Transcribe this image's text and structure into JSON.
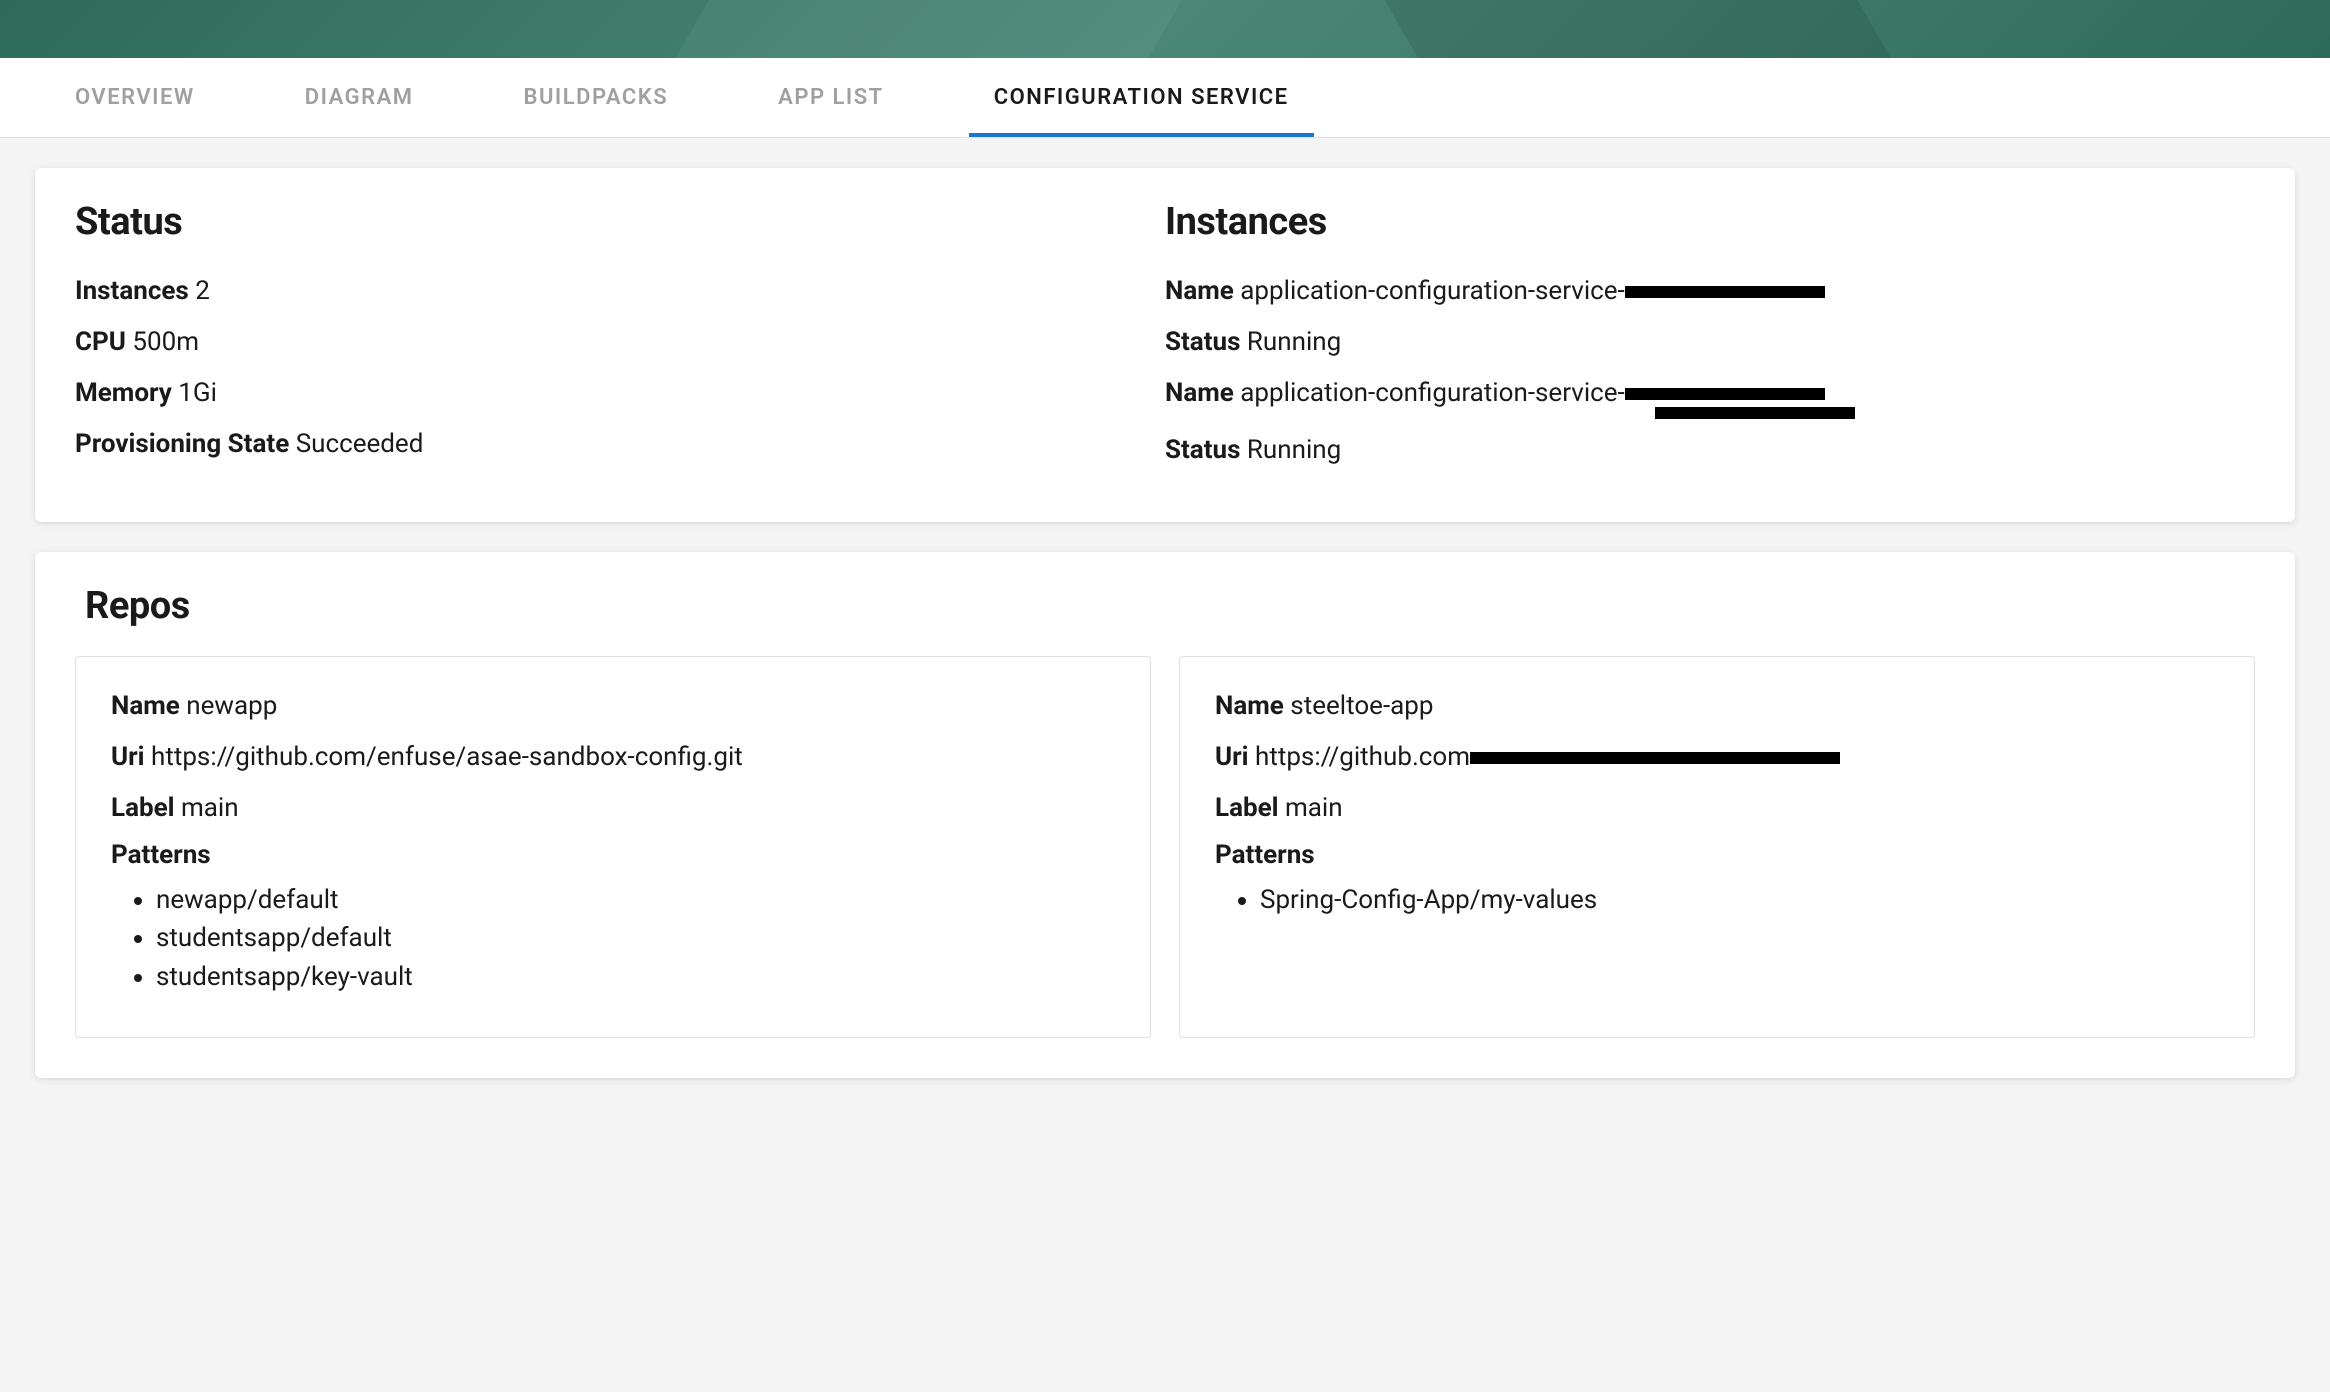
{
  "tabs": [
    {
      "label": "OVERVIEW",
      "active": false
    },
    {
      "label": "DIAGRAM",
      "active": false
    },
    {
      "label": "BUILDPACKS",
      "active": false
    },
    {
      "label": "APP LIST",
      "active": false
    },
    {
      "label": "CONFIGURATION SERVICE",
      "active": true
    }
  ],
  "status": {
    "title": "Status",
    "instances_label": "Instances",
    "instances_value": "2",
    "cpu_label": "CPU",
    "cpu_value": "500m",
    "memory_label": "Memory",
    "memory_value": "1Gi",
    "provisioning_label": "Provisioning State",
    "provisioning_value": "Succeeded"
  },
  "instances": {
    "title": "Instances",
    "items": [
      {
        "name_label": "Name",
        "name_value": "application-configuration-service-",
        "status_label": "Status",
        "status_value": "Running"
      },
      {
        "name_label": "Name",
        "name_value": "application-configuration-service-",
        "status_label": "Status",
        "status_value": "Running"
      }
    ]
  },
  "repos": {
    "title": "Repos",
    "items": [
      {
        "name_label": "Name",
        "name_value": "newapp",
        "uri_label": "Uri",
        "uri_value": "https://github.com/enfuse/asae-sandbox-config.git",
        "label_label": "Label",
        "label_value": "main",
        "patterns_label": "Patterns",
        "patterns": [
          "newapp/default",
          "studentsapp/default",
          "studentsapp/key-vault"
        ]
      },
      {
        "name_label": "Name",
        "name_value": "steeltoe-app",
        "uri_label": "Uri",
        "uri_value": "https://github.com",
        "label_label": "Label",
        "label_value": "main",
        "patterns_label": "Patterns",
        "patterns": [
          "Spring-Config-App/my-values"
        ]
      }
    ]
  }
}
